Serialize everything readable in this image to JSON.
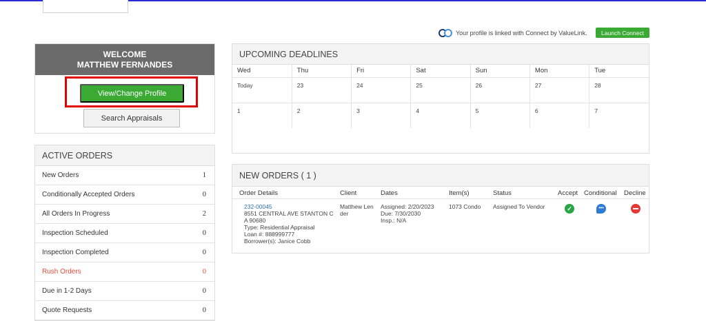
{
  "connect": {
    "text": "Your profile is linked with Connect by ValueLink.",
    "launch_label": "Launch Connect"
  },
  "welcome": {
    "line1": "WELCOME",
    "line2": "MATTHEW FERNANDES",
    "profile_label": "View/Change Profile",
    "search_label": "Search Appraisals"
  },
  "active_orders": {
    "title": "ACTIVE ORDERS",
    "items": [
      {
        "label": "New Orders",
        "count": "1"
      },
      {
        "label": "Conditionally Accepted Orders",
        "count": "0"
      },
      {
        "label": "All Orders In Progress",
        "count": "2"
      },
      {
        "label": "Inspection Scheduled",
        "count": "0"
      },
      {
        "label": "Inspection Completed",
        "count": "0"
      },
      {
        "label": "Rush Orders",
        "count": "0"
      },
      {
        "label": "Due in 1-2 Days",
        "count": "0"
      },
      {
        "label": "Quote Requests",
        "count": "0"
      }
    ]
  },
  "deadlines": {
    "title": "UPCOMING DEADLINES",
    "days": [
      "Wed",
      "Thu",
      "Fri",
      "Sat",
      "Sun",
      "Mon",
      "Tue"
    ],
    "week1": [
      "Today",
      "23",
      "24",
      "25",
      "26",
      "27",
      "28"
    ],
    "week2": [
      "1",
      "2",
      "3",
      "4",
      "5",
      "6",
      "7"
    ]
  },
  "new_orders": {
    "title": "NEW ORDERS ( 1 )",
    "columns": {
      "details": "Order Details",
      "client": "Client",
      "dates": "Dates",
      "items": "Item(s)",
      "status": "Status",
      "accept": "Accept",
      "conditional": "Conditional",
      "decline": "Decline"
    },
    "order": {
      "number": "232-00045",
      "address1": "8551 CENTRAL AVE STANTON C",
      "address2": "A 90680",
      "type": "Type: Residential Appraisal",
      "loan": "Loan #: 888999777",
      "borrower": "Borrower(s): Janice Cobb",
      "client1": "Matthew Len",
      "client2": "der",
      "assigned": "Assigned: 2/20/2023",
      "due": "Due: 7/30/2030",
      "insp": "Insp.: N/A",
      "items": "1073 Condo",
      "status": "Assigned To Vendor",
      "conditional_glyph": "•••"
    }
  }
}
